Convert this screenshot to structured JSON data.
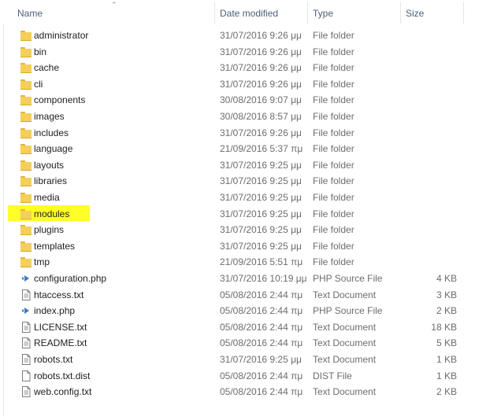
{
  "columns": {
    "name": "Name",
    "date_modified": "Date modified",
    "type": "Type",
    "size": "Size"
  },
  "colors": {
    "highlight": "#ffff28",
    "folder": "#f5cf5c",
    "header_text": "#4c607a"
  },
  "files": [
    {
      "name": "administrator",
      "date": "31/07/2016 9:26 μμ",
      "type": "File folder",
      "size": "",
      "icon": "folder-icon"
    },
    {
      "name": "bin",
      "date": "31/07/2016 9:26 μμ",
      "type": "File folder",
      "size": "",
      "icon": "folder-icon"
    },
    {
      "name": "cache",
      "date": "31/07/2016 9:26 μμ",
      "type": "File folder",
      "size": "",
      "icon": "folder-icon"
    },
    {
      "name": "cli",
      "date": "31/07/2016 9:26 μμ",
      "type": "File folder",
      "size": "",
      "icon": "folder-icon"
    },
    {
      "name": "components",
      "date": "30/08/2016 9:07 μμ",
      "type": "File folder",
      "size": "",
      "icon": "folder-icon"
    },
    {
      "name": "images",
      "date": "30/08/2016 8:57 μμ",
      "type": "File folder",
      "size": "",
      "icon": "folder-icon"
    },
    {
      "name": "includes",
      "date": "31/07/2016 9:26 μμ",
      "type": "File folder",
      "size": "",
      "icon": "folder-icon"
    },
    {
      "name": "language",
      "date": "21/09/2016 5:37 πμ",
      "type": "File folder",
      "size": "",
      "icon": "folder-icon"
    },
    {
      "name": "layouts",
      "date": "31/07/2016 9:25 μμ",
      "type": "File folder",
      "size": "",
      "icon": "folder-icon"
    },
    {
      "name": "libraries",
      "date": "31/07/2016 9:25 μμ",
      "type": "File folder",
      "size": "",
      "icon": "folder-icon"
    },
    {
      "name": "media",
      "date": "31/07/2016 9:25 μμ",
      "type": "File folder",
      "size": "",
      "icon": "folder-icon"
    },
    {
      "name": "modules",
      "date": "31/07/2016 9:25 μμ",
      "type": "File folder",
      "size": "",
      "icon": "folder-icon",
      "highlighted": true
    },
    {
      "name": "plugins",
      "date": "31/07/2016 9:25 μμ",
      "type": "File folder",
      "size": "",
      "icon": "folder-icon"
    },
    {
      "name": "templates",
      "date": "31/07/2016 9:25 μμ",
      "type": "File folder",
      "size": "",
      "icon": "folder-icon"
    },
    {
      "name": "tmp",
      "date": "21/09/2016 5:51 πμ",
      "type": "File folder",
      "size": "",
      "icon": "folder-icon"
    },
    {
      "name": "configuration.php",
      "date": "31/07/2016 10:19 μμ",
      "type": "PHP Source File",
      "size": "4 KB",
      "icon": "php-file-icon"
    },
    {
      "name": "htaccess.txt",
      "date": "05/08/2016 2:44 πμ",
      "type": "Text Document",
      "size": "3 KB",
      "icon": "text-document-icon"
    },
    {
      "name": "index.php",
      "date": "05/08/2016 2:44 πμ",
      "type": "PHP Source File",
      "size": "2 KB",
      "icon": "php-file-icon"
    },
    {
      "name": "LICENSE.txt",
      "date": "05/08/2016 2:44 πμ",
      "type": "Text Document",
      "size": "18 KB",
      "icon": "text-document-icon"
    },
    {
      "name": "README.txt",
      "date": "05/08/2016 2:44 πμ",
      "type": "Text Document",
      "size": "5 KB",
      "icon": "text-document-icon"
    },
    {
      "name": "robots.txt",
      "date": "31/07/2016 9:25 μμ",
      "type": "Text Document",
      "size": "1 KB",
      "icon": "text-document-icon"
    },
    {
      "name": "robots.txt.dist",
      "date": "05/08/2016 2:44 πμ",
      "type": "DIST File",
      "size": "1 KB",
      "icon": "blank-file-icon"
    },
    {
      "name": "web.config.txt",
      "date": "05/08/2016 2:44 πμ",
      "type": "Text Document",
      "size": "2 KB",
      "icon": "text-document-icon"
    }
  ]
}
